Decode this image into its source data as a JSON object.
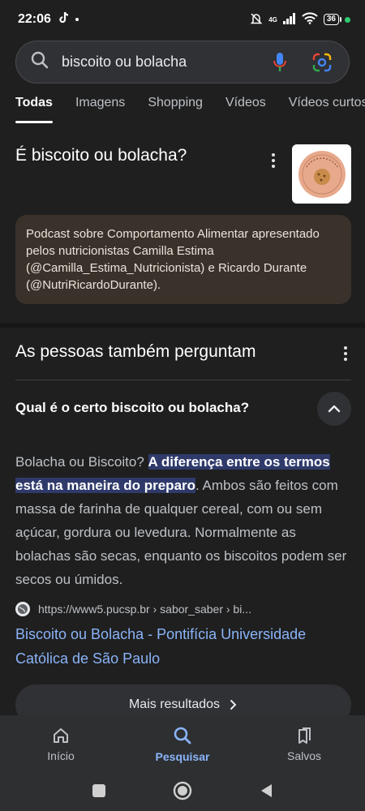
{
  "status": {
    "time": "22:06",
    "network": "4G",
    "battery": "36"
  },
  "search": {
    "query": "biscoito ou bolacha"
  },
  "tabs": [
    "Todas",
    "Imagens",
    "Shopping",
    "Vídeos",
    "Vídeos curtos"
  ],
  "knowledge_panel": {
    "title": "É biscoito ou bolacha?",
    "description": "Podcast sobre Comportamento Alimentar apresentado pelos nutricionistas Camilla Estima (@Camilla_Estima_Nutricionista) e Ricardo Durante (@NutriRicardoDurante)."
  },
  "paa": {
    "title": "As pessoas também perguntam",
    "question": "Qual é o certo biscoito ou bolacha?",
    "answer_pre": "Bolacha ou Biscoito? ",
    "answer_highlight": "A diferença entre os termos está na maneira do preparo",
    "answer_post": ". Ambos são feitos com massa de farinha de qualquer cereal, com ou sem açúcar, gordura ou levedura. Normalmente as bolachas são secas, enquanto os biscoitos podem ser secos ou úmidos.",
    "source_url": "https://www5.pucsp.br › sabor_saber › bi...",
    "result_title": "Biscoito ou Bolacha - Pontifícia Universidade Católica de São Paulo",
    "more_results": "Mais resultados"
  },
  "bottom_nav": {
    "home": "Início",
    "search": "Pesquisar",
    "saved": "Salvos"
  },
  "colors": {
    "link": "#8ab4f8",
    "highlight_bg": "#2f3a6a",
    "card_bg": "#3a322a"
  }
}
